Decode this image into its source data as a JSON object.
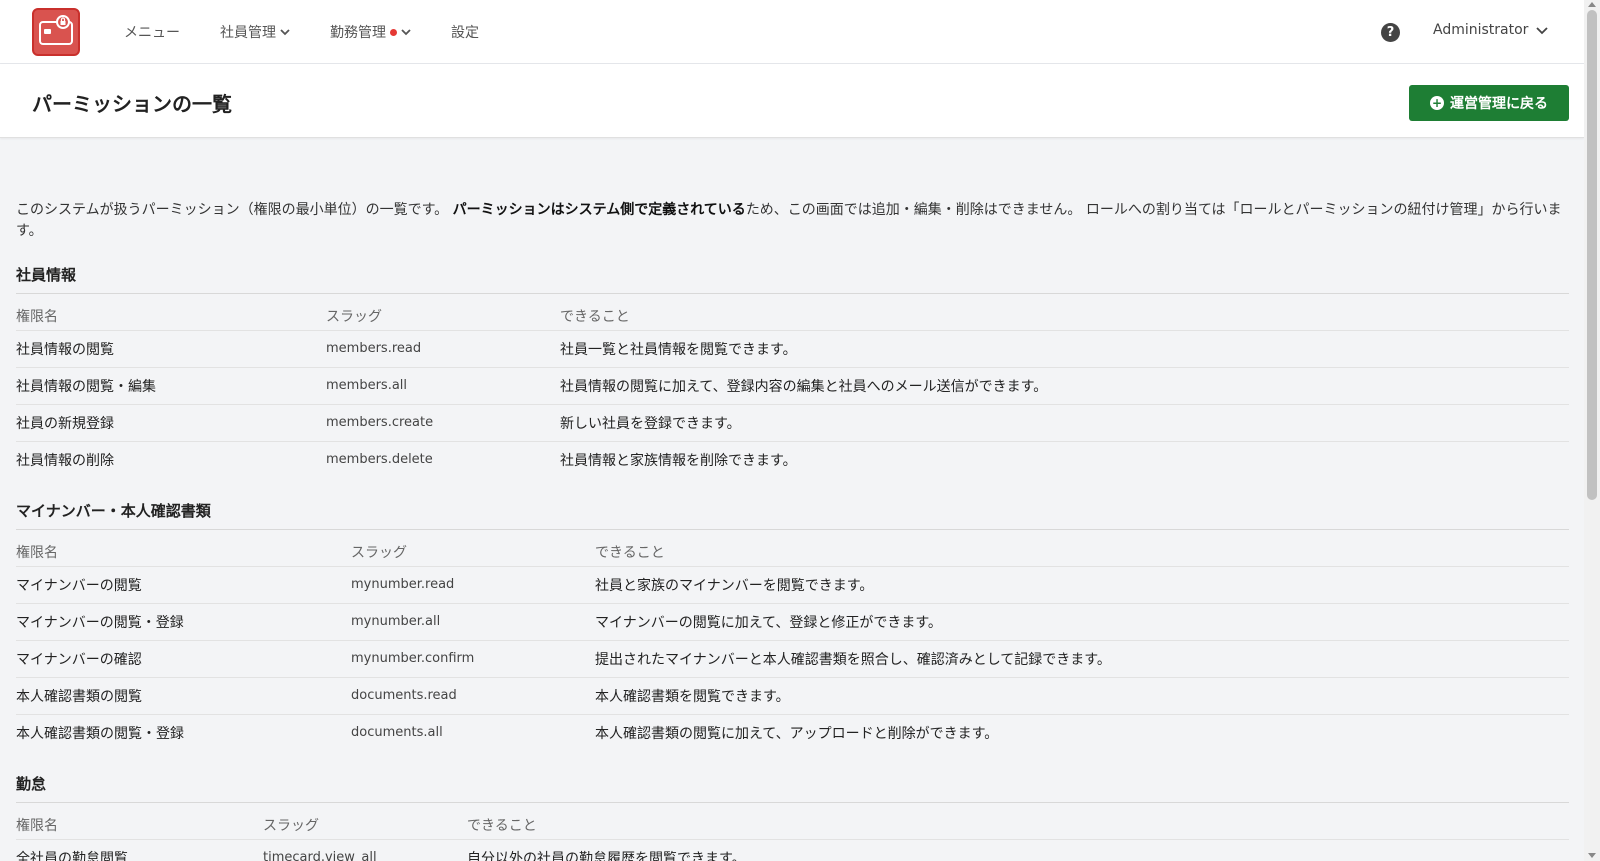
{
  "nav": {
    "menu": "メニュー",
    "members": "社員管理",
    "attendance": "勤務管理",
    "settings": "設定",
    "user": "Administrator"
  },
  "header": {
    "title": "パーミッションの一覧",
    "back_button": "運営管理に戻る"
  },
  "intro": {
    "part1": "このシステムが扱うパーミッション（権限の最小単位）の一覧です。",
    "bold": "パーミッションはシステム側で定義されている",
    "part2": "ため、この画面では追加・編集・削除はできません。 ロールへの割り当ては「ロールとパーミッションの紐付け管理」から行います。"
  },
  "columns": {
    "name": "権限名",
    "slug": "スラッグ",
    "desc": "できること"
  },
  "sections": [
    {
      "title": "社員情報",
      "rows": [
        {
          "name": "社員情報の閲覧",
          "slug": "members.read",
          "desc": "社員一覧と社員情報を閲覧できます。"
        },
        {
          "name": "社員情報の閲覧・編集",
          "slug": "members.all",
          "desc": "社員情報の閲覧に加えて、登録内容の編集と社員へのメール送信ができます。"
        },
        {
          "name": "社員の新規登録",
          "slug": "members.create",
          "desc": "新しい社員を登録できます。"
        },
        {
          "name": "社員情報の削除",
          "slug": "members.delete",
          "desc": "社員情報と家族情報を削除できます。"
        }
      ]
    },
    {
      "title": "マイナンバー・本人確認書類",
      "rows": [
        {
          "name": "マイナンバーの閲覧",
          "slug": "mynumber.read",
          "desc": "社員と家族のマイナンバーを閲覧できます。"
        },
        {
          "name": "マイナンバーの閲覧・登録",
          "slug": "mynumber.all",
          "desc": "マイナンバーの閲覧に加えて、登録と修正ができます。"
        },
        {
          "name": "マイナンバーの確認",
          "slug": "mynumber.confirm",
          "desc": "提出されたマイナンバーと本人確認書類を照合し、確認済みとして記録できます。"
        },
        {
          "name": "本人確認書類の閲覧",
          "slug": "documents.read",
          "desc": "本人確認書類を閲覧できます。"
        },
        {
          "name": "本人確認書類の閲覧・登録",
          "slug": "documents.all",
          "desc": "本人確認書類の閲覧に加えて、アップロードと削除ができます。"
        }
      ]
    },
    {
      "title": "勤怠",
      "rows": [
        {
          "name": "全社員の勤怠閲覧",
          "slug": "timecard.view_all",
          "desc": "自分以外の社員の勤怠履歴を閲覧できます。"
        }
      ]
    }
  ]
}
